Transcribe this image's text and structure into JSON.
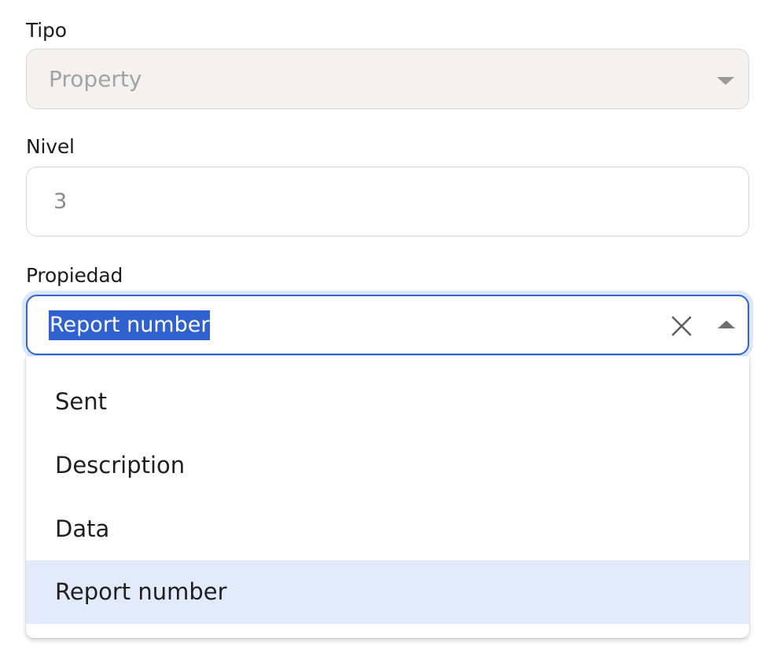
{
  "tipo": {
    "label": "Tipo",
    "value": "Property"
  },
  "nivel": {
    "label": "Nivel",
    "value": "3"
  },
  "propiedad": {
    "label": "Propiedad",
    "value": "Report number",
    "options": [
      {
        "label": "Sent"
      },
      {
        "label": "Description"
      },
      {
        "label": "Data"
      },
      {
        "label": "Report number",
        "highlighted": true
      }
    ]
  },
  "icons": {
    "tipo_caret": "chevron-down-icon",
    "clear": "close-icon",
    "propiedad_caret": "chevron-up-icon"
  },
  "colors": {
    "focus_border": "#2f64d8",
    "selection_bg": "#2f61cf",
    "option_highlight": "#e2ebfb",
    "disabled_bg": "#f3f2f0"
  }
}
